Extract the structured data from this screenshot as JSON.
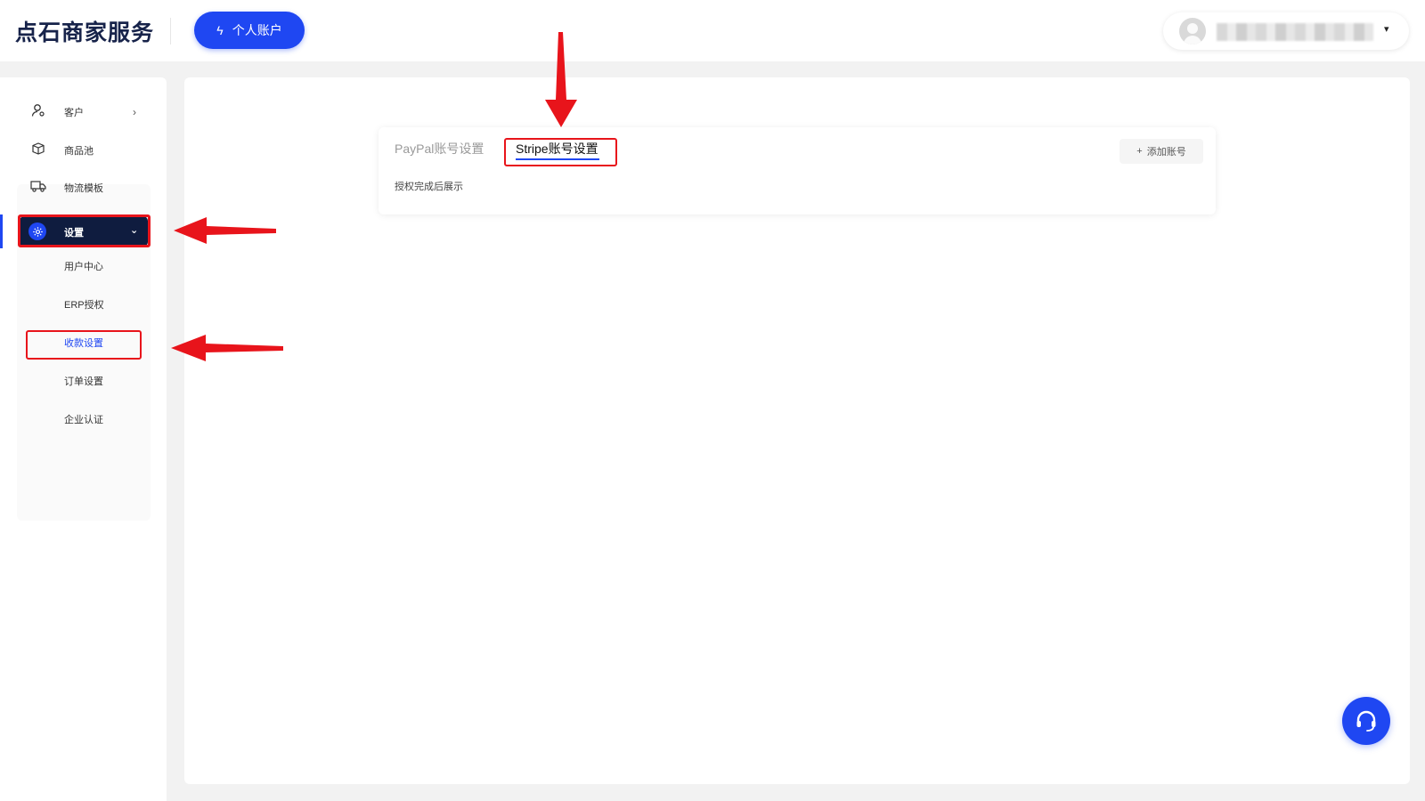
{
  "header": {
    "logo": "点石商家服务",
    "account_button": "个人账户",
    "user_dropdown_caret": "▾"
  },
  "sidebar": {
    "items": [
      {
        "label": "客户",
        "icon": "user-icon"
      },
      {
        "label": "商品池",
        "icon": "box-icon"
      },
      {
        "label": "物流模板",
        "icon": "truck-icon"
      }
    ],
    "active": {
      "label": "设置",
      "icon": "gear-icon"
    },
    "sub_items": [
      {
        "label": "用户中心"
      },
      {
        "label": "ERP授权"
      },
      {
        "label": "收款设置",
        "selected": true
      },
      {
        "label": "订单设置"
      },
      {
        "label": "企业认证"
      }
    ]
  },
  "main": {
    "tabs": [
      {
        "label": "PayPal账号设置",
        "active": false
      },
      {
        "label": "Stripe账号设置",
        "active": true
      }
    ],
    "add_button": "添加账号",
    "note": "授权完成后展示"
  },
  "colors": {
    "brand_blue": "#1f47f2",
    "active_menu_bg": "#0f1c3f",
    "annotation_red": "#e8141b"
  }
}
